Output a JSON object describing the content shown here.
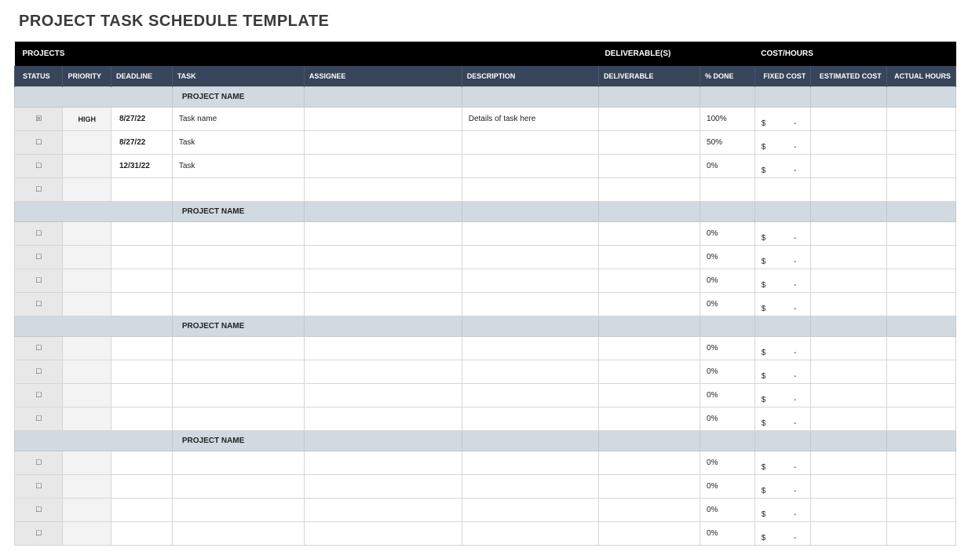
{
  "title": "PROJECT TASK SCHEDULE TEMPLATE",
  "sections": {
    "projects": "PROJECTS",
    "deliverables": "DELIVERABLE(S)",
    "cost_hours": "COST/HOURS"
  },
  "columns": {
    "status": "STATUS",
    "priority": "PRIORITY",
    "deadline": "DEADLINE",
    "task": "TASK",
    "assignee": "ASSIGNEE",
    "description": "DESCRIPTION",
    "deliverable": "DELIVERABLE",
    "percent_done": "% DONE",
    "fixed_cost": "FIXED COST",
    "estimated_cost": "ESTIMATED COST",
    "actual_hours": "ACTUAL HOURS"
  },
  "checkbox": {
    "checked": "☒",
    "unchecked": "☐"
  },
  "cost": {
    "symbol": "$",
    "dash": "-"
  },
  "groups": [
    {
      "name": "PROJECT NAME",
      "rows": [
        {
          "checked": true,
          "priority": "HIGH",
          "deadline": "8/27/22",
          "task": "Task name",
          "assignee": "",
          "description": "Details of task here",
          "deliverable": "",
          "percent_done": "100%",
          "fixed_cost": true,
          "estimated_cost": "",
          "actual_hours": ""
        },
        {
          "checked": false,
          "priority": "",
          "deadline": "8/27/22",
          "task": "Task",
          "assignee": "",
          "description": "",
          "deliverable": "",
          "percent_done": "50%",
          "fixed_cost": true,
          "estimated_cost": "",
          "actual_hours": ""
        },
        {
          "checked": false,
          "priority": "",
          "deadline": "12/31/22",
          "task": "Task",
          "assignee": "",
          "description": "",
          "deliverable": "",
          "percent_done": "0%",
          "fixed_cost": true,
          "estimated_cost": "",
          "actual_hours": ""
        },
        {
          "checked": false,
          "priority": "",
          "deadline": "",
          "task": "",
          "assignee": "",
          "description": "",
          "deliverable": "",
          "percent_done": "",
          "fixed_cost": false,
          "estimated_cost": "",
          "actual_hours": ""
        }
      ]
    },
    {
      "name": "PROJECT NAME",
      "rows": [
        {
          "checked": false,
          "priority": "",
          "deadline": "",
          "task": "",
          "assignee": "",
          "description": "",
          "deliverable": "",
          "percent_done": "0%",
          "fixed_cost": true,
          "estimated_cost": "",
          "actual_hours": ""
        },
        {
          "checked": false,
          "priority": "",
          "deadline": "",
          "task": "",
          "assignee": "",
          "description": "",
          "deliverable": "",
          "percent_done": "0%",
          "fixed_cost": true,
          "estimated_cost": "",
          "actual_hours": ""
        },
        {
          "checked": false,
          "priority": "",
          "deadline": "",
          "task": "",
          "assignee": "",
          "description": "",
          "deliverable": "",
          "percent_done": "0%",
          "fixed_cost": true,
          "estimated_cost": "",
          "actual_hours": ""
        },
        {
          "checked": false,
          "priority": "",
          "deadline": "",
          "task": "",
          "assignee": "",
          "description": "",
          "deliverable": "",
          "percent_done": "0%",
          "fixed_cost": true,
          "estimated_cost": "",
          "actual_hours": ""
        }
      ]
    },
    {
      "name": "PROJECT NAME",
      "rows": [
        {
          "checked": false,
          "priority": "",
          "deadline": "",
          "task": "",
          "assignee": "",
          "description": "",
          "deliverable": "",
          "percent_done": "0%",
          "fixed_cost": true,
          "estimated_cost": "",
          "actual_hours": ""
        },
        {
          "checked": false,
          "priority": "",
          "deadline": "",
          "task": "",
          "assignee": "",
          "description": "",
          "deliverable": "",
          "percent_done": "0%",
          "fixed_cost": true,
          "estimated_cost": "",
          "actual_hours": ""
        },
        {
          "checked": false,
          "priority": "",
          "deadline": "",
          "task": "",
          "assignee": "",
          "description": "",
          "deliverable": "",
          "percent_done": "0%",
          "fixed_cost": true,
          "estimated_cost": "",
          "actual_hours": ""
        },
        {
          "checked": false,
          "priority": "",
          "deadline": "",
          "task": "",
          "assignee": "",
          "description": "",
          "deliverable": "",
          "percent_done": "0%",
          "fixed_cost": true,
          "estimated_cost": "",
          "actual_hours": ""
        }
      ]
    },
    {
      "name": "PROJECT NAME",
      "rows": [
        {
          "checked": false,
          "priority": "",
          "deadline": "",
          "task": "",
          "assignee": "",
          "description": "",
          "deliverable": "",
          "percent_done": "0%",
          "fixed_cost": true,
          "estimated_cost": "",
          "actual_hours": ""
        },
        {
          "checked": false,
          "priority": "",
          "deadline": "",
          "task": "",
          "assignee": "",
          "description": "",
          "deliverable": "",
          "percent_done": "0%",
          "fixed_cost": true,
          "estimated_cost": "",
          "actual_hours": ""
        },
        {
          "checked": false,
          "priority": "",
          "deadline": "",
          "task": "",
          "assignee": "",
          "description": "",
          "deliverable": "",
          "percent_done": "0%",
          "fixed_cost": true,
          "estimated_cost": "",
          "actual_hours": ""
        },
        {
          "checked": false,
          "priority": "",
          "deadline": "",
          "task": "",
          "assignee": "",
          "description": "",
          "deliverable": "",
          "percent_done": "0%",
          "fixed_cost": true,
          "estimated_cost": "",
          "actual_hours": ""
        }
      ]
    }
  ]
}
